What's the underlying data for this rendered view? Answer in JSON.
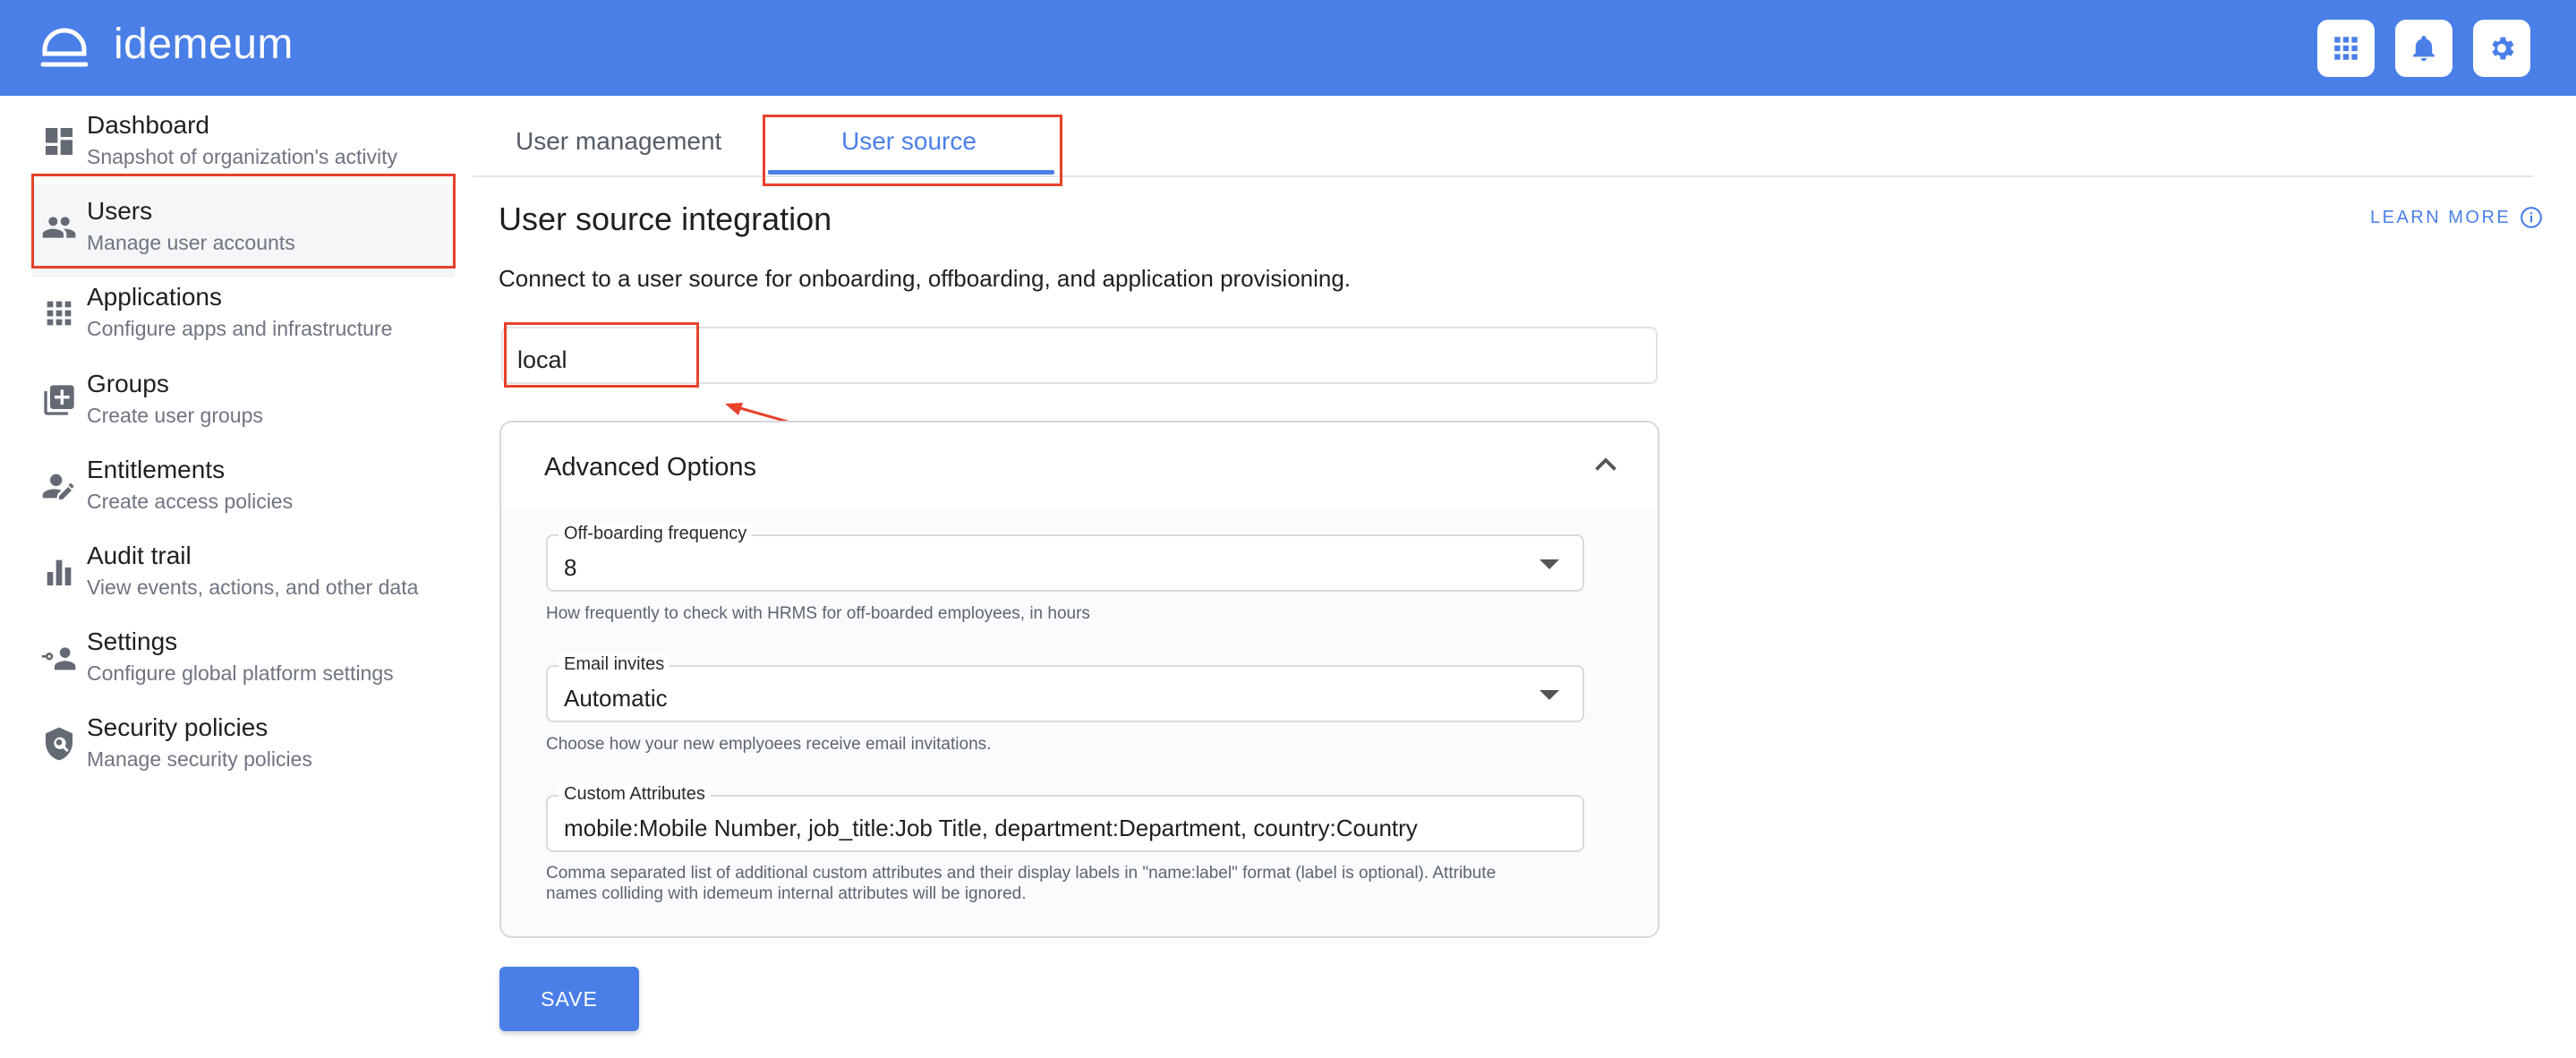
{
  "app": {
    "name": "idemeum"
  },
  "header_icons": [
    "apps-grid-icon",
    "bell-icon",
    "gear-icon"
  ],
  "sidebar": {
    "items": [
      {
        "label": "Dashboard",
        "sub": "Snapshot of organization's activity",
        "icon": "dashboard-icon"
      },
      {
        "label": "Users",
        "sub": "Manage user accounts",
        "icon": "users-icon"
      },
      {
        "label": "Applications",
        "sub": "Configure apps and infrastructure",
        "icon": "apps-grid-icon"
      },
      {
        "label": "Groups",
        "sub": "Create user groups",
        "icon": "group-add-icon"
      },
      {
        "label": "Entitlements",
        "sub": "Create access policies",
        "icon": "person-edit-icon"
      },
      {
        "label": "Audit trail",
        "sub": "View events, actions, and other data",
        "icon": "bar-chart-icon"
      },
      {
        "label": "Settings",
        "sub": "Configure global platform settings",
        "icon": "person-key-icon"
      },
      {
        "label": "Security policies",
        "sub": "Manage security policies",
        "icon": "shield-search-icon"
      }
    ],
    "active_index": 1
  },
  "tabs": [
    {
      "label": "User management",
      "active": false
    },
    {
      "label": "User source",
      "active": true
    }
  ],
  "main": {
    "title": "User source integration",
    "learn_more": "LEARN MORE",
    "description": "Connect to a user source for onboarding, offboarding, and application provisioning.",
    "user_source_value": "local",
    "advanced": {
      "title": "Advanced Options",
      "expanded": true,
      "offboarding": {
        "label": "Off-boarding frequency",
        "value": "8",
        "helper": "How frequently to check with HRMS for off-boarded employees, in hours"
      },
      "email_invites": {
        "label": "Email invites",
        "value": "Automatic",
        "helper": "Choose how your new emplyoees receive email invitations."
      },
      "custom_attributes": {
        "label": "Custom Attributes",
        "value": "mobile:Mobile Number, job_title:Job Title, department:Department, country:Country",
        "helper_line1": "Comma separated list of additional custom attributes and their display labels in \"name:label\" format (label is optional). Attribute",
        "helper_line2": "names colliding with idemeum internal attributes will be ignored."
      }
    },
    "save_label": "SAVE"
  },
  "colors": {
    "brand": "#4a7fe8",
    "annotation": "#e8412c",
    "icon_gray": "#646a73"
  }
}
